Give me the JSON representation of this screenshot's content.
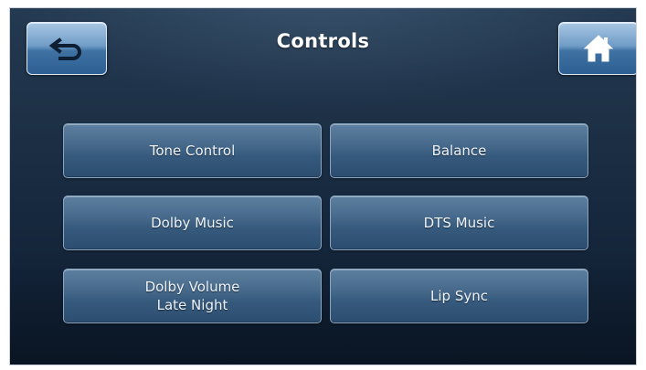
{
  "header": {
    "title": "Controls"
  },
  "nav": {
    "back_icon": "back-arrow-icon",
    "home_icon": "home-icon",
    "accent_color": "#5f8fbd"
  },
  "menu": {
    "items": [
      {
        "label": "Tone Control"
      },
      {
        "label": "Balance"
      },
      {
        "label": "Dolby Music"
      },
      {
        "label": "DTS Music"
      },
      {
        "label": "Dolby Volume\nLate Night"
      },
      {
        "label": "Lip Sync"
      }
    ]
  }
}
